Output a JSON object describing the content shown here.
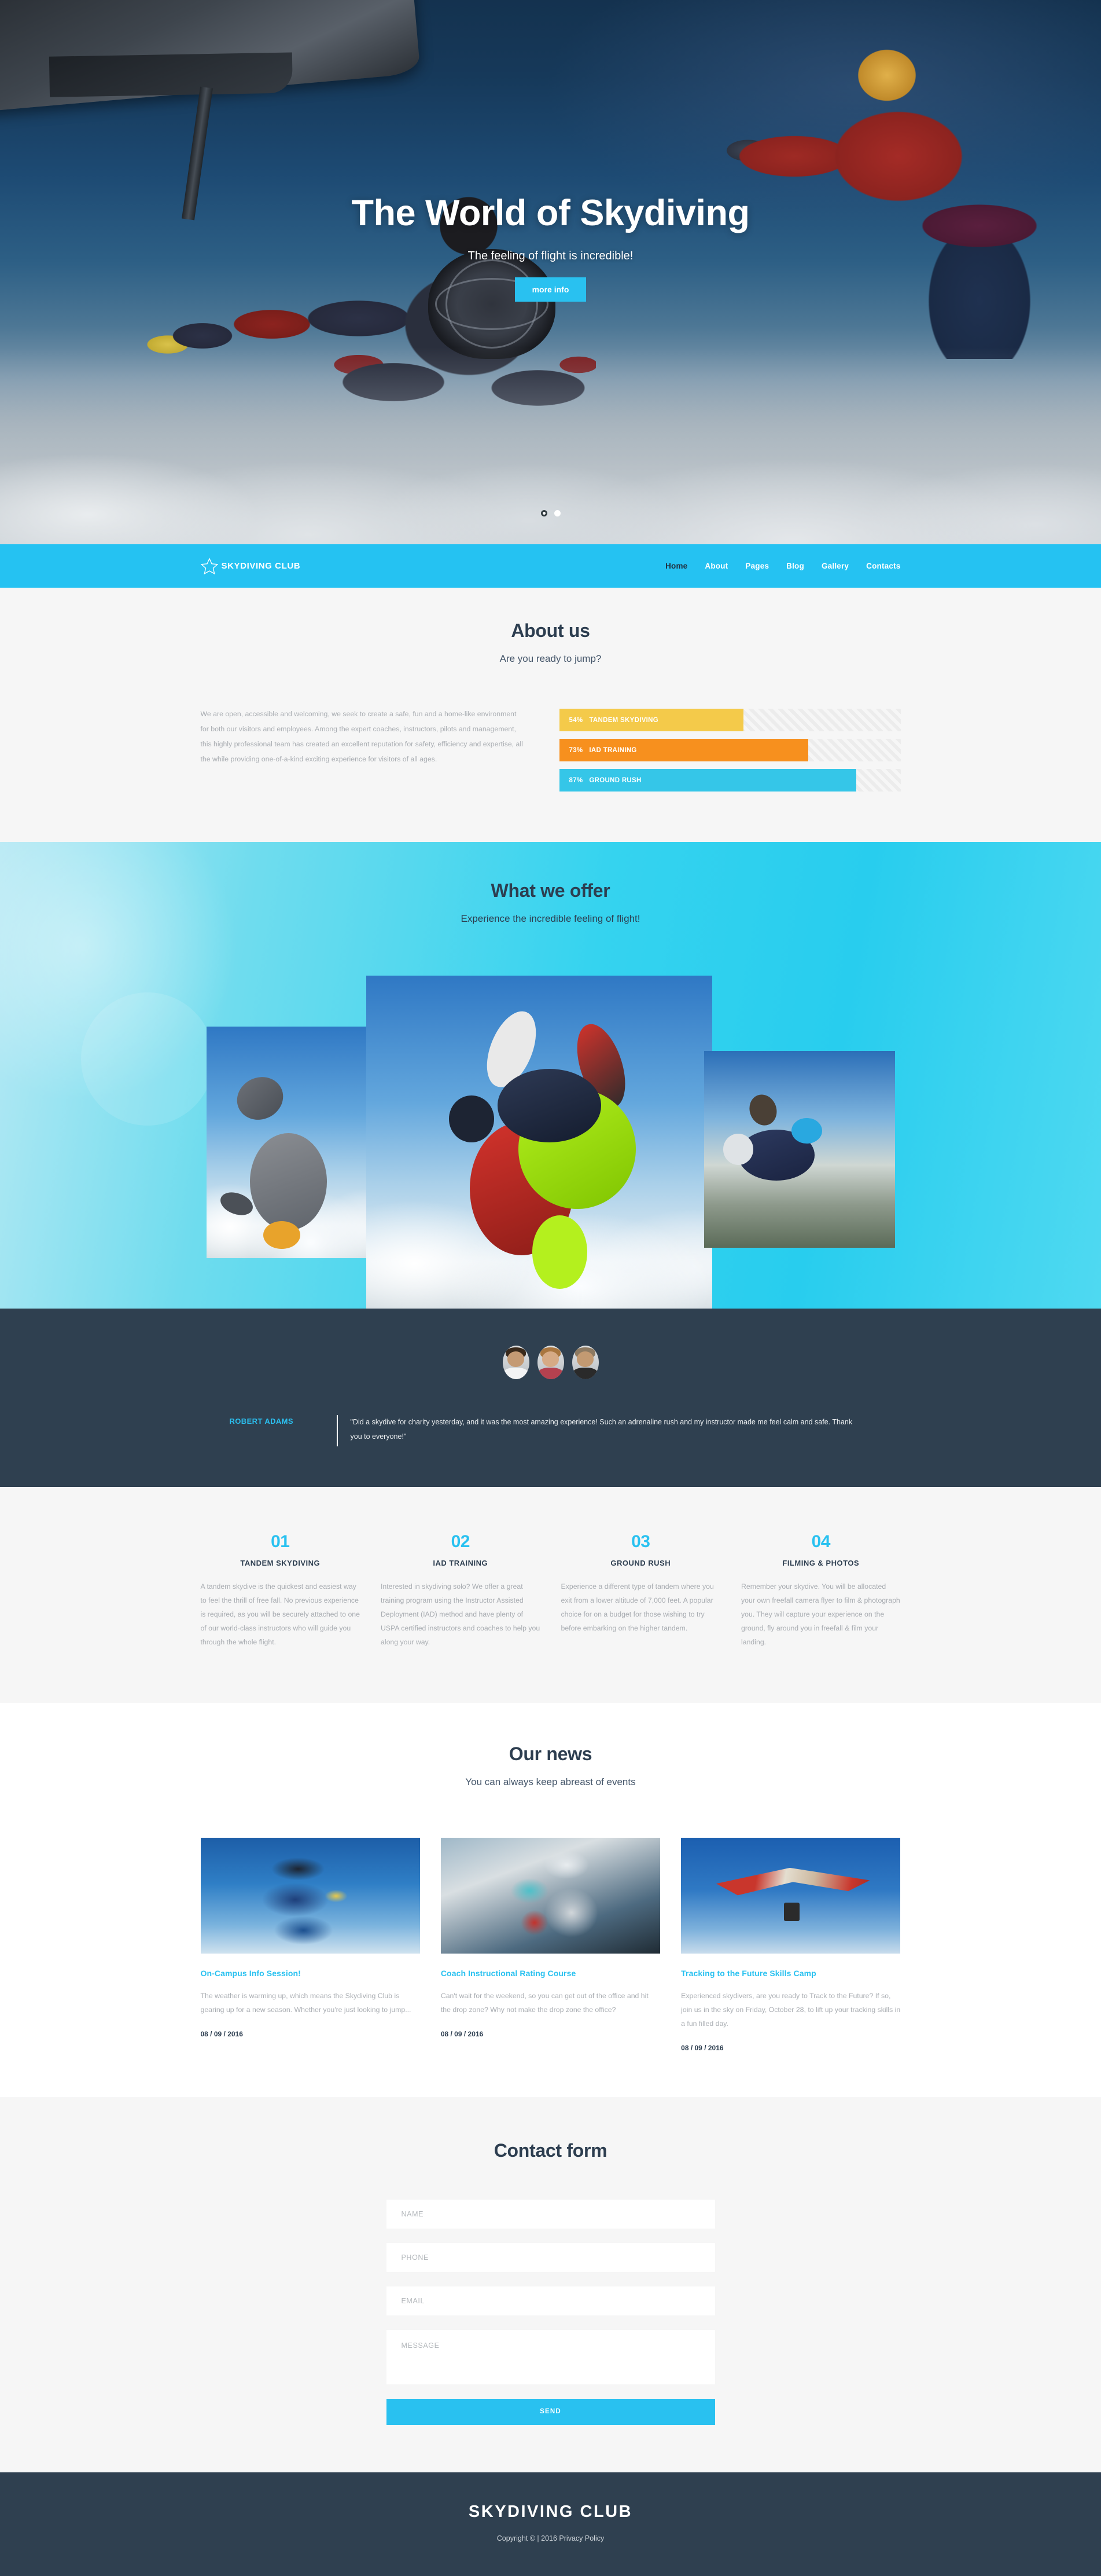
{
  "hero": {
    "title": "The World of Skydiving",
    "subtitle": "The feeling of flight is incredible!",
    "button": "more info",
    "slide_dots": [
      "active",
      "idle"
    ]
  },
  "nav": {
    "brand": "SKYDIVING CLUB",
    "brand_icon": "star-icon",
    "items": [
      {
        "label": "Home",
        "active": true
      },
      {
        "label": "About",
        "active": false
      },
      {
        "label": "Pages",
        "active": false
      },
      {
        "label": "Blog",
        "active": false
      },
      {
        "label": "Gallery",
        "active": false
      },
      {
        "label": "Contacts",
        "active": false
      }
    ]
  },
  "about": {
    "title": "About us",
    "subtitle": "Are you ready to jump?",
    "paragraph": "We are open, accessible and welcoming, we seek to create a safe, fun and a home-like environment for both our visitors and employees. Among the expert coaches, instructors, pilots and management, this highly professional team has created an excellent reputation for safety, efficiency and expertise, all the while providing one-of-a-kind exciting experience for visitors of all ages.",
    "skills": [
      {
        "percent": "54%",
        "label": "TANDEM SKYDIVING",
        "value": 54,
        "color": "#f4ca4a"
      },
      {
        "percent": "73%",
        "label": "IAD TRAINING",
        "value": 73,
        "color": "#f7901e"
      },
      {
        "percent": "87%",
        "label": "GROUND RUSH",
        "value": 87,
        "color": "#35c6e8"
      }
    ]
  },
  "offer": {
    "title": "What we offer",
    "subtitle": "Experience the incredible feeling of flight!",
    "images": [
      "skydiver-head-down-photo",
      "tandem-skydivers-photo",
      "solo-skydiver-over-landscape-photo"
    ]
  },
  "testimonial": {
    "avatars": [
      "avatar-male-1",
      "avatar-female-1",
      "avatar-male-2"
    ],
    "author": "ROBERT ADAMS",
    "quote": "\"Did a skydive for charity yesterday, and it was the most amazing experience! Such an adrenaline rush and my instructor made me feel calm and safe. Thank you to everyone!\""
  },
  "services": [
    {
      "number": "01",
      "title": "TANDEM SKYDIVING",
      "text": "A tandem skydive is the quickest and easiest way to feel the thrill of free fall. No previous experience is required, as you will be securely attached to one of our world-class instructors who will guide you through the whole flight."
    },
    {
      "number": "02",
      "title": "IAD TRAINING",
      "text": "Interested in skydiving solo? We offer a great training program using the Instructor Assisted Deployment (IAD) method and have plenty of USPA certified instructors and coaches to help you along your way."
    },
    {
      "number": "03",
      "title": "GROUND RUSH",
      "text": "Experience a different type of tandem where you exit from a lower altitude of 7,000 feet. A popular choice for on a budget for those wishing to try before embarking on the higher tandem."
    },
    {
      "number": "04",
      "title": "FILMING & PHOTOS",
      "text": "Remember your skydive. You will be allocated your own freefall camera flyer to film & photograph you. They will capture your experience on the ground, fly around you in freefall & film your landing."
    }
  ],
  "news": {
    "title": "Our news",
    "subtitle": "You can always keep abreast of events",
    "posts": [
      {
        "image": "tandem-jumpers-thumbs-up-photo",
        "title": "On-Campus Info Session!",
        "text": "The weather is warming up, which means the Skydiving Club is gearing up for a new season. Whether you're just looking to jump...",
        "date": "08 / 09 / 2016"
      },
      {
        "image": "skydivers-in-aircraft-door-photo",
        "title": "Coach Instructional Rating Course",
        "text": "Can't wait for the weekend, so you can get out of the office and hit the drop zone? Why not make the drop zone the office?",
        "date": "08 / 09 / 2016"
      },
      {
        "image": "hang-glider-in-sky-photo",
        "title": "Tracking to the Future Skills Camp",
        "text": "Experienced skydivers, are you ready to Track to the Future? If so, join us in the sky on Friday, October 28, to lift up your tracking skills in a fun filled day.",
        "date": "08 / 09 / 2016"
      }
    ]
  },
  "contact": {
    "title": "Contact form",
    "fields": [
      {
        "name": "name",
        "placeholder": "NAME",
        "value": ""
      },
      {
        "name": "phone",
        "placeholder": "PHONE",
        "value": ""
      },
      {
        "name": "email",
        "placeholder": "EMAIL",
        "value": ""
      }
    ],
    "message_placeholder": "MESSAGE",
    "message_value": "",
    "send_label": "SEND"
  },
  "footer": {
    "logo": "SKYDIVING CLUB",
    "copyright": "Copyright © | 2016 Privacy Policy"
  },
  "colors": {
    "accent": "#29c1f0",
    "nav": "#25c2f2",
    "dark": "#2f4050",
    "heading": "#2d3e50",
    "body_text": "#a9adb2",
    "light_bg": "#f6f6f6"
  }
}
